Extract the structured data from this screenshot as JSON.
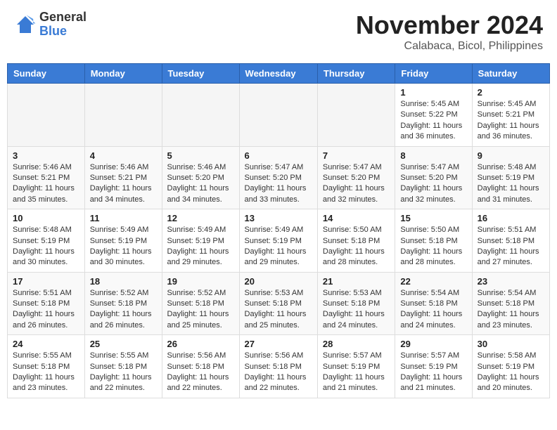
{
  "header": {
    "logo_general": "General",
    "logo_blue": "Blue",
    "month_title": "November 2024",
    "location": "Calabaca, Bicol, Philippines"
  },
  "days_of_week": [
    "Sunday",
    "Monday",
    "Tuesday",
    "Wednesday",
    "Thursday",
    "Friday",
    "Saturday"
  ],
  "weeks": [
    [
      {
        "day": "",
        "info": ""
      },
      {
        "day": "",
        "info": ""
      },
      {
        "day": "",
        "info": ""
      },
      {
        "day": "",
        "info": ""
      },
      {
        "day": "",
        "info": ""
      },
      {
        "day": "1",
        "info": "Sunrise: 5:45 AM\nSunset: 5:22 PM\nDaylight: 11 hours and 36 minutes."
      },
      {
        "day": "2",
        "info": "Sunrise: 5:45 AM\nSunset: 5:21 PM\nDaylight: 11 hours and 36 minutes."
      }
    ],
    [
      {
        "day": "3",
        "info": "Sunrise: 5:46 AM\nSunset: 5:21 PM\nDaylight: 11 hours and 35 minutes."
      },
      {
        "day": "4",
        "info": "Sunrise: 5:46 AM\nSunset: 5:21 PM\nDaylight: 11 hours and 34 minutes."
      },
      {
        "day": "5",
        "info": "Sunrise: 5:46 AM\nSunset: 5:20 PM\nDaylight: 11 hours and 34 minutes."
      },
      {
        "day": "6",
        "info": "Sunrise: 5:47 AM\nSunset: 5:20 PM\nDaylight: 11 hours and 33 minutes."
      },
      {
        "day": "7",
        "info": "Sunrise: 5:47 AM\nSunset: 5:20 PM\nDaylight: 11 hours and 32 minutes."
      },
      {
        "day": "8",
        "info": "Sunrise: 5:47 AM\nSunset: 5:20 PM\nDaylight: 11 hours and 32 minutes."
      },
      {
        "day": "9",
        "info": "Sunrise: 5:48 AM\nSunset: 5:19 PM\nDaylight: 11 hours and 31 minutes."
      }
    ],
    [
      {
        "day": "10",
        "info": "Sunrise: 5:48 AM\nSunset: 5:19 PM\nDaylight: 11 hours and 30 minutes."
      },
      {
        "day": "11",
        "info": "Sunrise: 5:49 AM\nSunset: 5:19 PM\nDaylight: 11 hours and 30 minutes."
      },
      {
        "day": "12",
        "info": "Sunrise: 5:49 AM\nSunset: 5:19 PM\nDaylight: 11 hours and 29 minutes."
      },
      {
        "day": "13",
        "info": "Sunrise: 5:49 AM\nSunset: 5:19 PM\nDaylight: 11 hours and 29 minutes."
      },
      {
        "day": "14",
        "info": "Sunrise: 5:50 AM\nSunset: 5:18 PM\nDaylight: 11 hours and 28 minutes."
      },
      {
        "day": "15",
        "info": "Sunrise: 5:50 AM\nSunset: 5:18 PM\nDaylight: 11 hours and 28 minutes."
      },
      {
        "day": "16",
        "info": "Sunrise: 5:51 AM\nSunset: 5:18 PM\nDaylight: 11 hours and 27 minutes."
      }
    ],
    [
      {
        "day": "17",
        "info": "Sunrise: 5:51 AM\nSunset: 5:18 PM\nDaylight: 11 hours and 26 minutes."
      },
      {
        "day": "18",
        "info": "Sunrise: 5:52 AM\nSunset: 5:18 PM\nDaylight: 11 hours and 26 minutes."
      },
      {
        "day": "19",
        "info": "Sunrise: 5:52 AM\nSunset: 5:18 PM\nDaylight: 11 hours and 25 minutes."
      },
      {
        "day": "20",
        "info": "Sunrise: 5:53 AM\nSunset: 5:18 PM\nDaylight: 11 hours and 25 minutes."
      },
      {
        "day": "21",
        "info": "Sunrise: 5:53 AM\nSunset: 5:18 PM\nDaylight: 11 hours and 24 minutes."
      },
      {
        "day": "22",
        "info": "Sunrise: 5:54 AM\nSunset: 5:18 PM\nDaylight: 11 hours and 24 minutes."
      },
      {
        "day": "23",
        "info": "Sunrise: 5:54 AM\nSunset: 5:18 PM\nDaylight: 11 hours and 23 minutes."
      }
    ],
    [
      {
        "day": "24",
        "info": "Sunrise: 5:55 AM\nSunset: 5:18 PM\nDaylight: 11 hours and 23 minutes."
      },
      {
        "day": "25",
        "info": "Sunrise: 5:55 AM\nSunset: 5:18 PM\nDaylight: 11 hours and 22 minutes."
      },
      {
        "day": "26",
        "info": "Sunrise: 5:56 AM\nSunset: 5:18 PM\nDaylight: 11 hours and 22 minutes."
      },
      {
        "day": "27",
        "info": "Sunrise: 5:56 AM\nSunset: 5:18 PM\nDaylight: 11 hours and 22 minutes."
      },
      {
        "day": "28",
        "info": "Sunrise: 5:57 AM\nSunset: 5:19 PM\nDaylight: 11 hours and 21 minutes."
      },
      {
        "day": "29",
        "info": "Sunrise: 5:57 AM\nSunset: 5:19 PM\nDaylight: 11 hours and 21 minutes."
      },
      {
        "day": "30",
        "info": "Sunrise: 5:58 AM\nSunset: 5:19 PM\nDaylight: 11 hours and 20 minutes."
      }
    ]
  ]
}
